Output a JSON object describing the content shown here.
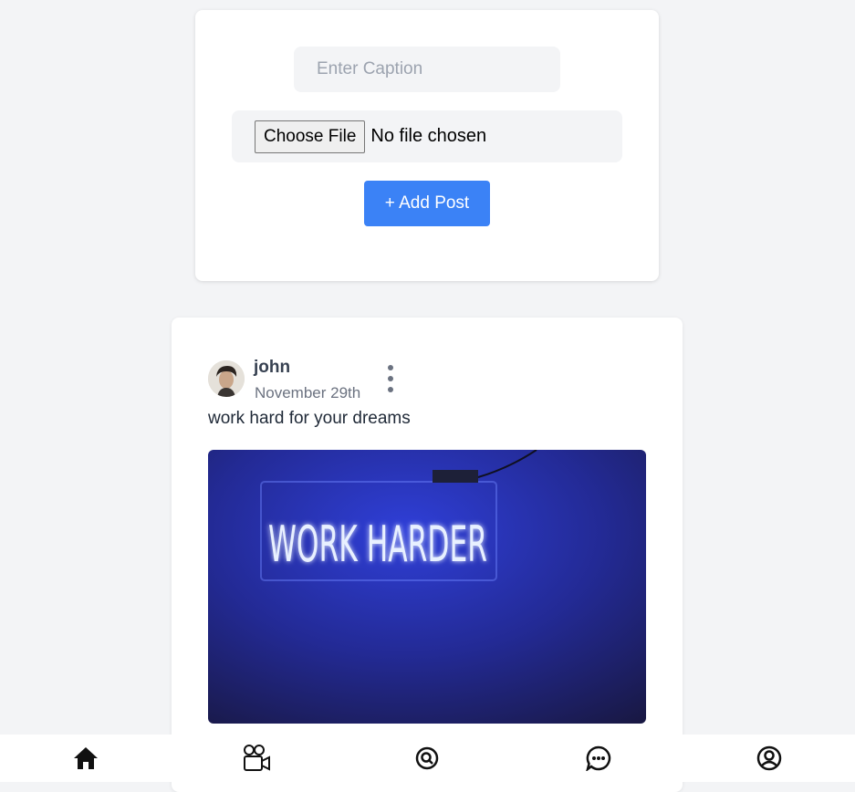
{
  "create_post": {
    "caption_placeholder": "Enter Caption",
    "choose_file_label": "Choose File",
    "file_status": "No file chosen",
    "add_post_label": "+ Add Post"
  },
  "post": {
    "username": "john",
    "date": "November 29th",
    "caption": "work hard for your dreams",
    "image_text": "WORK HARDER"
  },
  "bottom_nav": {
    "items": [
      "home-icon",
      "video-camera-icon",
      "search-icon",
      "chat-icon",
      "user-circle-icon"
    ]
  },
  "colors": {
    "accent": "#3b82f6",
    "background": "#f3f4f6",
    "neon": "#dbeafe"
  }
}
